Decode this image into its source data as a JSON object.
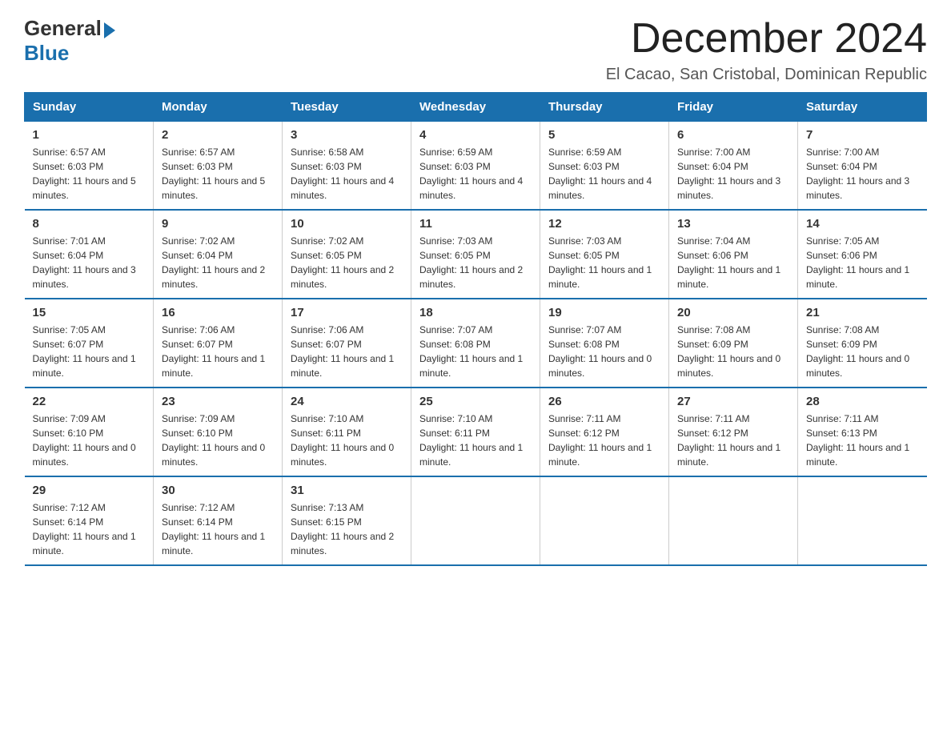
{
  "logo": {
    "general": "General",
    "blue": "Blue"
  },
  "header": {
    "month": "December 2024",
    "location": "El Cacao, San Cristobal, Dominican Republic"
  },
  "weekdays": [
    "Sunday",
    "Monday",
    "Tuesday",
    "Wednesday",
    "Thursday",
    "Friday",
    "Saturday"
  ],
  "weeks": [
    [
      {
        "day": "1",
        "sunrise": "6:57 AM",
        "sunset": "6:03 PM",
        "daylight": "11 hours and 5 minutes."
      },
      {
        "day": "2",
        "sunrise": "6:57 AM",
        "sunset": "6:03 PM",
        "daylight": "11 hours and 5 minutes."
      },
      {
        "day": "3",
        "sunrise": "6:58 AM",
        "sunset": "6:03 PM",
        "daylight": "11 hours and 4 minutes."
      },
      {
        "day": "4",
        "sunrise": "6:59 AM",
        "sunset": "6:03 PM",
        "daylight": "11 hours and 4 minutes."
      },
      {
        "day": "5",
        "sunrise": "6:59 AM",
        "sunset": "6:03 PM",
        "daylight": "11 hours and 4 minutes."
      },
      {
        "day": "6",
        "sunrise": "7:00 AM",
        "sunset": "6:04 PM",
        "daylight": "11 hours and 3 minutes."
      },
      {
        "day": "7",
        "sunrise": "7:00 AM",
        "sunset": "6:04 PM",
        "daylight": "11 hours and 3 minutes."
      }
    ],
    [
      {
        "day": "8",
        "sunrise": "7:01 AM",
        "sunset": "6:04 PM",
        "daylight": "11 hours and 3 minutes."
      },
      {
        "day": "9",
        "sunrise": "7:02 AM",
        "sunset": "6:04 PM",
        "daylight": "11 hours and 2 minutes."
      },
      {
        "day": "10",
        "sunrise": "7:02 AM",
        "sunset": "6:05 PM",
        "daylight": "11 hours and 2 minutes."
      },
      {
        "day": "11",
        "sunrise": "7:03 AM",
        "sunset": "6:05 PM",
        "daylight": "11 hours and 2 minutes."
      },
      {
        "day": "12",
        "sunrise": "7:03 AM",
        "sunset": "6:05 PM",
        "daylight": "11 hours and 1 minute."
      },
      {
        "day": "13",
        "sunrise": "7:04 AM",
        "sunset": "6:06 PM",
        "daylight": "11 hours and 1 minute."
      },
      {
        "day": "14",
        "sunrise": "7:05 AM",
        "sunset": "6:06 PM",
        "daylight": "11 hours and 1 minute."
      }
    ],
    [
      {
        "day": "15",
        "sunrise": "7:05 AM",
        "sunset": "6:07 PM",
        "daylight": "11 hours and 1 minute."
      },
      {
        "day": "16",
        "sunrise": "7:06 AM",
        "sunset": "6:07 PM",
        "daylight": "11 hours and 1 minute."
      },
      {
        "day": "17",
        "sunrise": "7:06 AM",
        "sunset": "6:07 PM",
        "daylight": "11 hours and 1 minute."
      },
      {
        "day": "18",
        "sunrise": "7:07 AM",
        "sunset": "6:08 PM",
        "daylight": "11 hours and 1 minute."
      },
      {
        "day": "19",
        "sunrise": "7:07 AM",
        "sunset": "6:08 PM",
        "daylight": "11 hours and 0 minutes."
      },
      {
        "day": "20",
        "sunrise": "7:08 AM",
        "sunset": "6:09 PM",
        "daylight": "11 hours and 0 minutes."
      },
      {
        "day": "21",
        "sunrise": "7:08 AM",
        "sunset": "6:09 PM",
        "daylight": "11 hours and 0 minutes."
      }
    ],
    [
      {
        "day": "22",
        "sunrise": "7:09 AM",
        "sunset": "6:10 PM",
        "daylight": "11 hours and 0 minutes."
      },
      {
        "day": "23",
        "sunrise": "7:09 AM",
        "sunset": "6:10 PM",
        "daylight": "11 hours and 0 minutes."
      },
      {
        "day": "24",
        "sunrise": "7:10 AM",
        "sunset": "6:11 PM",
        "daylight": "11 hours and 0 minutes."
      },
      {
        "day": "25",
        "sunrise": "7:10 AM",
        "sunset": "6:11 PM",
        "daylight": "11 hours and 1 minute."
      },
      {
        "day": "26",
        "sunrise": "7:11 AM",
        "sunset": "6:12 PM",
        "daylight": "11 hours and 1 minute."
      },
      {
        "day": "27",
        "sunrise": "7:11 AM",
        "sunset": "6:12 PM",
        "daylight": "11 hours and 1 minute."
      },
      {
        "day": "28",
        "sunrise": "7:11 AM",
        "sunset": "6:13 PM",
        "daylight": "11 hours and 1 minute."
      }
    ],
    [
      {
        "day": "29",
        "sunrise": "7:12 AM",
        "sunset": "6:14 PM",
        "daylight": "11 hours and 1 minute."
      },
      {
        "day": "30",
        "sunrise": "7:12 AM",
        "sunset": "6:14 PM",
        "daylight": "11 hours and 1 minute."
      },
      {
        "day": "31",
        "sunrise": "7:13 AM",
        "sunset": "6:15 PM",
        "daylight": "11 hours and 2 minutes."
      },
      null,
      null,
      null,
      null
    ]
  ]
}
